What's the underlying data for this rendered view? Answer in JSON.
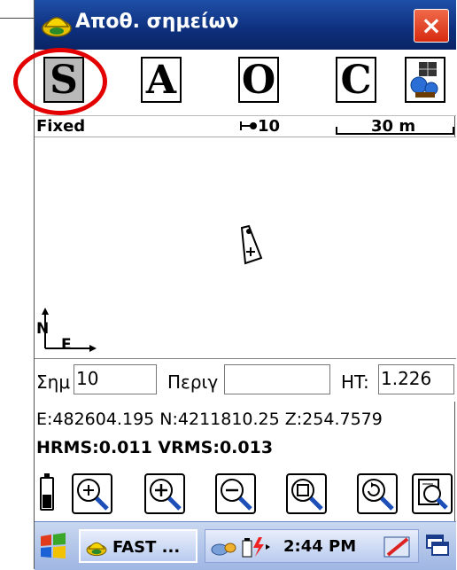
{
  "window": {
    "title": "Αποθ. σημείων",
    "close_label": "×"
  },
  "modes": [
    "S",
    "A",
    "O",
    "C"
  ],
  "status": {
    "fix": "Fixed",
    "scale_step": "10",
    "scale_length": "30 m"
  },
  "map": {
    "north_label": "N",
    "east_label": "E"
  },
  "inputs": {
    "point_label": "Σημ",
    "point_value": "10",
    "desc_label": "Περιγ",
    "desc_value": "",
    "ht_label": "HT:",
    "ht_value": "1.226"
  },
  "coords": "E:482604.195 N:4211810.25 Z:254.7579",
  "rms": "HRMS:0.011 VRMS:0.013",
  "taskbar": {
    "app_label": "FAST ...",
    "time": "2:44 PM"
  },
  "battery_level": 0.45,
  "colors": {
    "title_bar": "#0d2f7c",
    "close": "#d62a10",
    "highlight_ring": "#e30000",
    "active_mode": "#b9b9b9"
  }
}
